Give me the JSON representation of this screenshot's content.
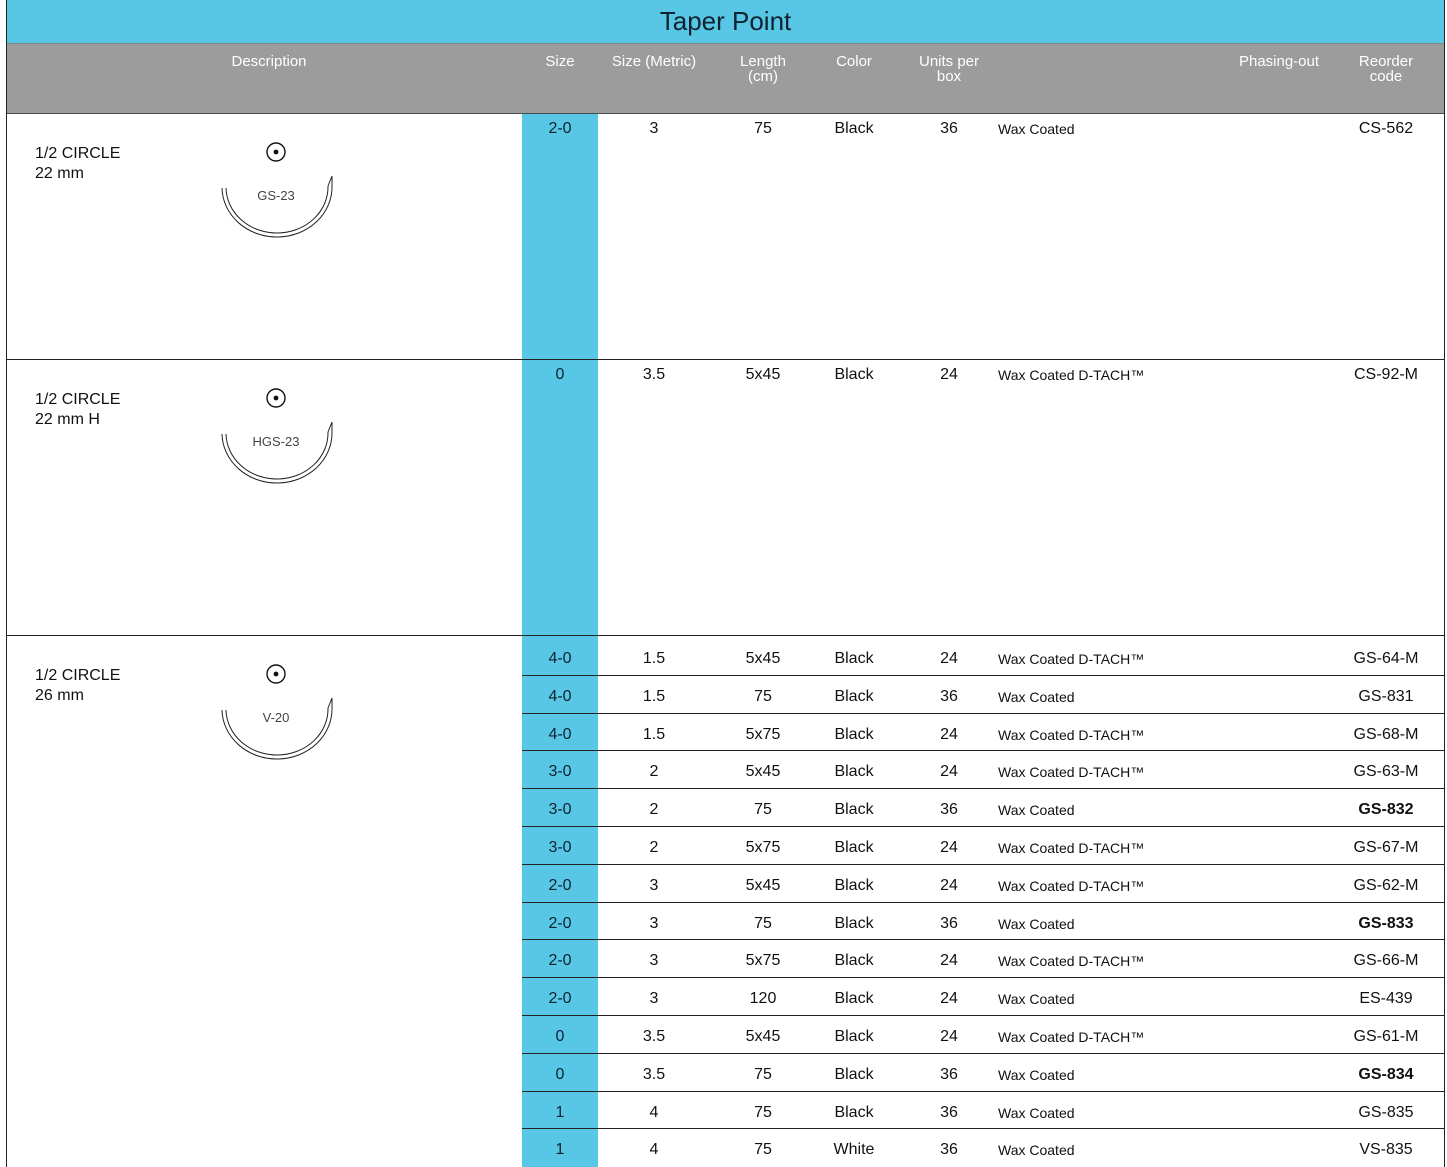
{
  "title": "Taper Point",
  "headers": {
    "description": "Description",
    "size": "Size",
    "size_metric": "Size (Metric)",
    "length": "Length\n(cm)",
    "color": "Color",
    "units": "Units per\nbox",
    "phasing": "Phasing-out",
    "reorder": "Reorder\ncode"
  },
  "colors": {
    "accent": "#58c7e6",
    "header_bg": "#9c9c9c"
  },
  "sections": [
    {
      "shape": "1/2 CIRCLE\n22 mm",
      "needle_code": "GS-23",
      "needle_icon": "half-circle-needle-icon",
      "rows": [
        {
          "size": "2-0",
          "metric": "3",
          "length": "75",
          "color": "Black",
          "units": "36",
          "coating": "Wax Coated",
          "dtach": "",
          "code": "CS-562",
          "bold": false
        }
      ]
    },
    {
      "shape": "1/2 CIRCLE\n22 mm H",
      "needle_code": "HGS-23",
      "needle_icon": "half-circle-needle-icon",
      "rows": [
        {
          "size": "0",
          "metric": "3.5",
          "length": "5x45",
          "color": "Black",
          "units": "24",
          "coating": "Wax Coated",
          "dtach": "D-TACH™",
          "code": "CS-92-M",
          "bold": false
        }
      ]
    },
    {
      "shape": "1/2 CIRCLE\n26 mm",
      "needle_code": "V-20",
      "needle_icon": "half-circle-needle-icon",
      "rows": [
        {
          "size": "4-0",
          "metric": "1.5",
          "length": "5x45",
          "color": "Black",
          "units": "24",
          "coating": "Wax Coated",
          "dtach": "D-TACH™",
          "code": "GS-64-M",
          "bold": false
        },
        {
          "size": "4-0",
          "metric": "1.5",
          "length": "75",
          "color": "Black",
          "units": "36",
          "coating": "Wax Coated",
          "dtach": "",
          "code": "GS-831",
          "bold": false
        },
        {
          "size": "4-0",
          "metric": "1.5",
          "length": "5x75",
          "color": "Black",
          "units": "24",
          "coating": "Wax Coated",
          "dtach": "D-TACH™",
          "code": "GS-68-M",
          "bold": false
        },
        {
          "size": "3-0",
          "metric": "2",
          "length": "5x45",
          "color": "Black",
          "units": "24",
          "coating": "Wax Coated",
          "dtach": "D-TACH™",
          "code": "GS-63-M",
          "bold": false
        },
        {
          "size": "3-0",
          "metric": "2",
          "length": "75",
          "color": "Black",
          "units": "36",
          "coating": "Wax Coated",
          "dtach": "",
          "code": "GS-832",
          "bold": true
        },
        {
          "size": "3-0",
          "metric": "2",
          "length": "5x75",
          "color": "Black",
          "units": "24",
          "coating": "Wax Coated",
          "dtach": "D-TACH™",
          "code": "GS-67-M",
          "bold": false
        },
        {
          "size": "2-0",
          "metric": "3",
          "length": "5x45",
          "color": "Black",
          "units": "24",
          "coating": "Wax Coated",
          "dtach": "D-TACH™",
          "code": "GS-62-M",
          "bold": false
        },
        {
          "size": "2-0",
          "metric": "3",
          "length": "75",
          "color": "Black",
          "units": "36",
          "coating": "Wax Coated",
          "dtach": "",
          "code": "GS-833",
          "bold": true
        },
        {
          "size": "2-0",
          "metric": "3",
          "length": "5x75",
          "color": "Black",
          "units": "24",
          "coating": "Wax Coated",
          "dtach": "D-TACH™",
          "code": "GS-66-M",
          "bold": false
        },
        {
          "size": "2-0",
          "metric": "3",
          "length": "120",
          "color": "Black",
          "units": "24",
          "coating": "Wax Coated",
          "dtach": "",
          "code": "ES-439",
          "bold": false
        },
        {
          "size": "0",
          "metric": "3.5",
          "length": "5x45",
          "color": "Black",
          "units": "24",
          "coating": "Wax Coated",
          "dtach": "D-TACH™",
          "code": "GS-61-M",
          "bold": false
        },
        {
          "size": "0",
          "metric": "3.5",
          "length": "75",
          "color": "Black",
          "units": "36",
          "coating": "Wax Coated",
          "dtach": "",
          "code": "GS-834",
          "bold": true
        },
        {
          "size": "1",
          "metric": "4",
          "length": "75",
          "color": "Black",
          "units": "36",
          "coating": "Wax Coated",
          "dtach": "",
          "code": "GS-835",
          "bold": false
        },
        {
          "size": "1",
          "metric": "4",
          "length": "75",
          "color": "White",
          "units": "36",
          "coating": "Wax Coated",
          "dtach": "",
          "code": "VS-835",
          "bold": false
        }
      ]
    }
  ]
}
